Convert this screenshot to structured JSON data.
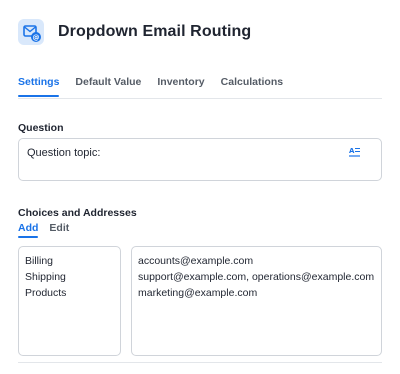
{
  "header": {
    "title": "Dropdown Email Routing",
    "icon": "email-routing-icon",
    "accent": "#1a73e8"
  },
  "tabs": [
    {
      "label": "Settings",
      "active": true
    },
    {
      "label": "Default Value",
      "active": false
    },
    {
      "label": "Inventory",
      "active": false
    },
    {
      "label": "Calculations",
      "active": false
    }
  ],
  "question": {
    "label": "Question",
    "value": "Question topic:",
    "format_icon": "text-format-icon"
  },
  "choices": {
    "label": "Choices and Addresses",
    "subtabs": [
      {
        "label": "Add",
        "active": true
      },
      {
        "label": "Edit",
        "active": false
      }
    ],
    "options": [
      "Billing",
      "Shipping",
      "Products"
    ],
    "addresses": [
      "accounts@example.com",
      "support@example.com, operations@example.com",
      "marketing@example.com"
    ]
  }
}
